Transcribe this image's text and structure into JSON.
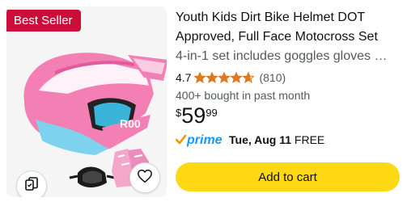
{
  "product": {
    "badge": "Best Seller",
    "title": "Youth Kids Dirt Bike Helmet DOT Approved, Full Face Motocross Set",
    "subtitle": "4-in-1 set includes goggles gloves …",
    "rating": "4.7",
    "rating_stars": 4.7,
    "review_count": "(810)",
    "bought": "400+ bought in past month",
    "price": {
      "symbol": "$",
      "whole": "59",
      "fraction": "99"
    },
    "prime": {
      "logo_text": "prime",
      "delivery_day": "Tue, Aug 11",
      "delivery_cost": "FREE"
    },
    "add_to_cart": "Add to cart"
  },
  "colors": {
    "badge_bg": "#cc0c39",
    "star": "#de7921",
    "prime_blue": "#1399ff",
    "prime_check": "#f79400",
    "cart_button": "#ffd814",
    "helmet_pink": "#f47fb4",
    "helmet_blue": "#7dd3ee"
  },
  "icons": [
    "compare-icon",
    "heart-icon",
    "star-icon",
    "prime-check-icon"
  ]
}
